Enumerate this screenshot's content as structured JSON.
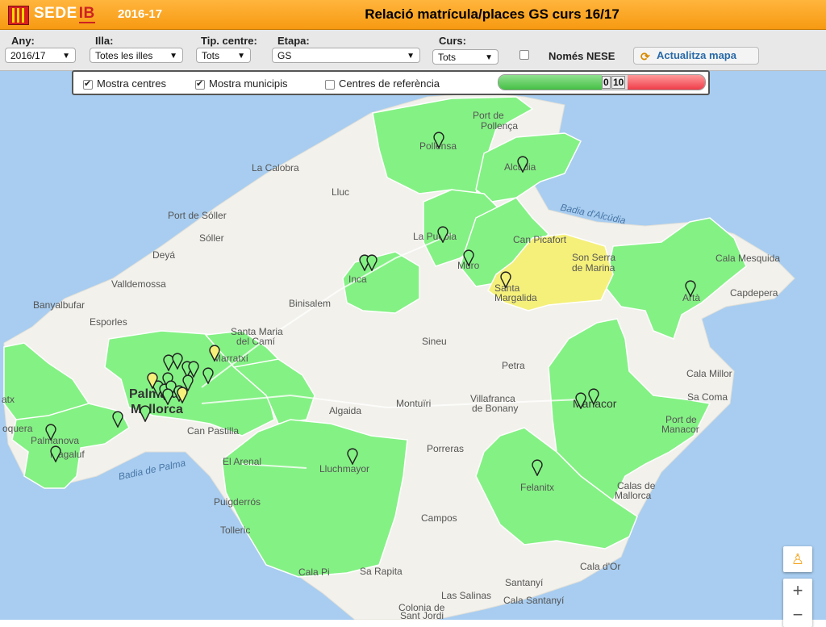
{
  "header": {
    "brand_main": "SEDE",
    "brand_ib": "IB",
    "year": "2016-17",
    "title": "Relació matrícula/places GS curs 16/17"
  },
  "filters": {
    "any": {
      "label": "Any:",
      "value": "2016/17"
    },
    "illa": {
      "label": "Illa:",
      "value": "Totes les illes"
    },
    "tip_centre": {
      "label": "Tip. centre:",
      "value": "Tots"
    },
    "etapa": {
      "label": "Etapa:",
      "value": "GS"
    },
    "curs": {
      "label": "Curs:",
      "value": "Tots"
    },
    "nese_label": "Només NESE",
    "update_label": "Actualitza mapa"
  },
  "overlay": {
    "show_centres": "Mostra centres",
    "show_municipis": "Mostra municipis",
    "reference_centres": "Centres de referència",
    "scale_min": "0",
    "scale_max": "10"
  },
  "colors": {
    "green": "#84f184",
    "yellow": "#f5f07a",
    "land": "#f2f1ec",
    "sea": "#a8cdf0"
  },
  "map_labels": {
    "port_pollenca": "Port de",
    "port_pollenca2": "Pollença",
    "pollensa": "Pollensa",
    "la_calobra": "La Calobra",
    "alcudia": "Alcúdia",
    "lluc": "Lluc",
    "port_soller": "Port de Sóller",
    "badia_alcudia": "Badia d'Alcúdia",
    "puebla": "La Puebla",
    "soller": "Sóller",
    "can_picafort": "Can Picafort",
    "deya": "Deyá",
    "son_serra": "Son Serra",
    "son_serra2": "de Marina",
    "cala_mesquida": "Cala Mesquida",
    "muro": "Muro",
    "inca": "Inca",
    "valldemossa": "Valldemossa",
    "santa_margalida": "Santa",
    "santa_margalida2": "Margalida",
    "capdepera": "Capdepera",
    "arta": "Artà",
    "banyalbufar": "Banyalbufar",
    "binisalem": "Binisalem",
    "esporles": "Esporles",
    "santa_maria": "Santa Maria",
    "santa_maria2": "del Camí",
    "sineu": "Sineu",
    "marratxi": "Marratxí",
    "cala_millor": "Cala Millor",
    "petra": "Petra",
    "palma": "Palma de",
    "palma2": "Mallorca",
    "sa_coma": "Sa Coma",
    "montuiri": "Montuïri",
    "villafranca": "Villafranca",
    "villafranca2": "de Bonany",
    "algaida": "Algaida",
    "manacor": "Manacor",
    "andratx": "atx",
    "can_pastilla": "Can Pastilla",
    "port_manacor": "Port de",
    "port_manacor2": "Manacor",
    "soquera": "oquera",
    "palmanova": "Palmanova",
    "magaluf": "Magaluf",
    "porreras": "Porreras",
    "el_arenal": "El Arenal",
    "lluchmayor": "Lluchmayor",
    "badia_palma": "Badia de Palma",
    "calas_mallorca": "Calas de",
    "calas_mallorca2": "Mallorca",
    "felanitx": "Felanitx",
    "campos": "Campos",
    "puigderros": "Puigderrós",
    "tolleric": "Tolleric",
    "cala_dor": "Cala d'Or",
    "cala_pi": "Cala Pi",
    "sa_rapita": "Sa Rapita",
    "santanyi": "Santanyí",
    "las_salinas": "Las Salinas",
    "cala_santanyi": "Cala Santanyí",
    "colonia": "Colonia de",
    "colonia2": "Sant Jordi"
  }
}
